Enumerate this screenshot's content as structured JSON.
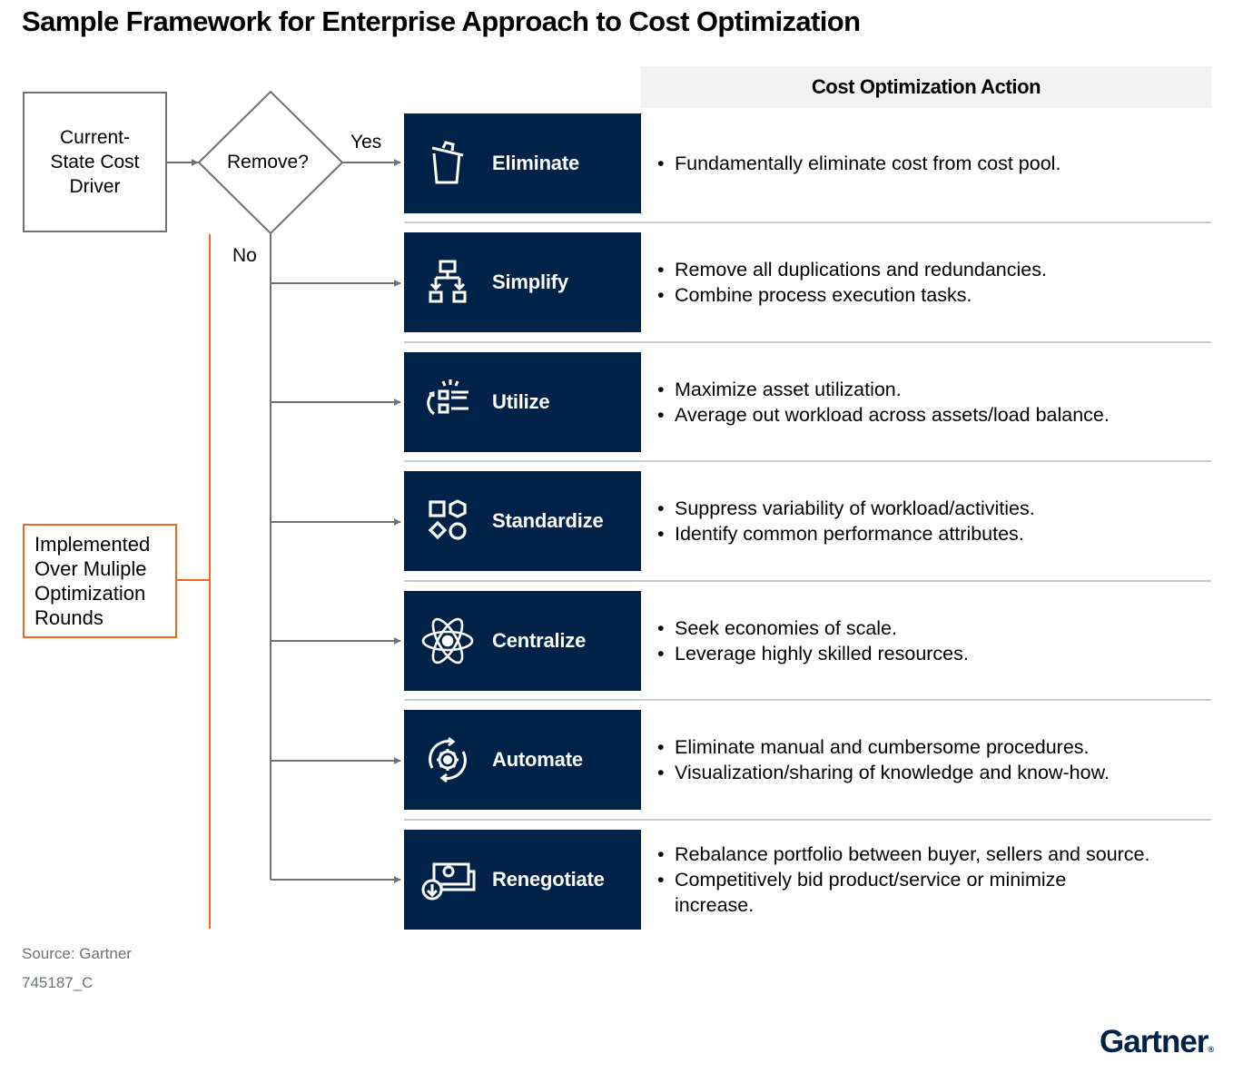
{
  "title": "Sample Framework for Enterprise Approach to Cost Optimization",
  "column_header": "Cost Optimization Action",
  "flow": {
    "start_node": "Current-\nState Cost\nDriver",
    "start_lines": [
      "Current-",
      "State Cost",
      "Driver"
    ],
    "decision": "Remove?",
    "yes_label": "Yes",
    "no_label": "No",
    "rounds_lines": [
      "Implemented",
      "Over Muliple",
      "Optimization",
      "Rounds"
    ]
  },
  "actions": [
    {
      "name": "Eliminate",
      "icon": "trash-can-icon",
      "bullets": [
        "Fundamentally eliminate cost from cost pool."
      ]
    },
    {
      "name": "Simplify",
      "icon": "hierarchy-diagram-icon",
      "bullets": [
        "Remove all duplications and redundancies.",
        "Combine process execution tasks."
      ]
    },
    {
      "name": "Utilize",
      "icon": "list-cycle-icon",
      "bullets": [
        "Maximize asset utilization.",
        "Average out workload across assets/load balance."
      ]
    },
    {
      "name": "Standardize",
      "icon": "shapes-icon",
      "bullets": [
        "Suppress variability of workload/activities.",
        "Identify common performance attributes."
      ]
    },
    {
      "name": "Centralize",
      "icon": "atom-icon",
      "bullets": [
        "Seek economies of scale.",
        "Leverage highly skilled resources."
      ]
    },
    {
      "name": "Automate",
      "icon": "gear-cycle-icon",
      "bullets": [
        "Eliminate manual and cumbersome procedures.",
        "Visualization/sharing of knowledge and know-how."
      ]
    },
    {
      "name": "Renegotiate",
      "icon": "money-download-icon",
      "bullets": [
        "Rebalance portfolio between buyer, sellers and source.",
        "Competitively bid product/service or minimize increase."
      ]
    }
  ],
  "colors": {
    "navy": "#002248",
    "orange": "#f26522",
    "connector": "#6b7373",
    "header_bg": "#f2f2f2"
  },
  "footer": {
    "source": "Source: Gartner",
    "id": "745187_C"
  },
  "logo": {
    "text": "Gartner",
    "mark": "®"
  }
}
